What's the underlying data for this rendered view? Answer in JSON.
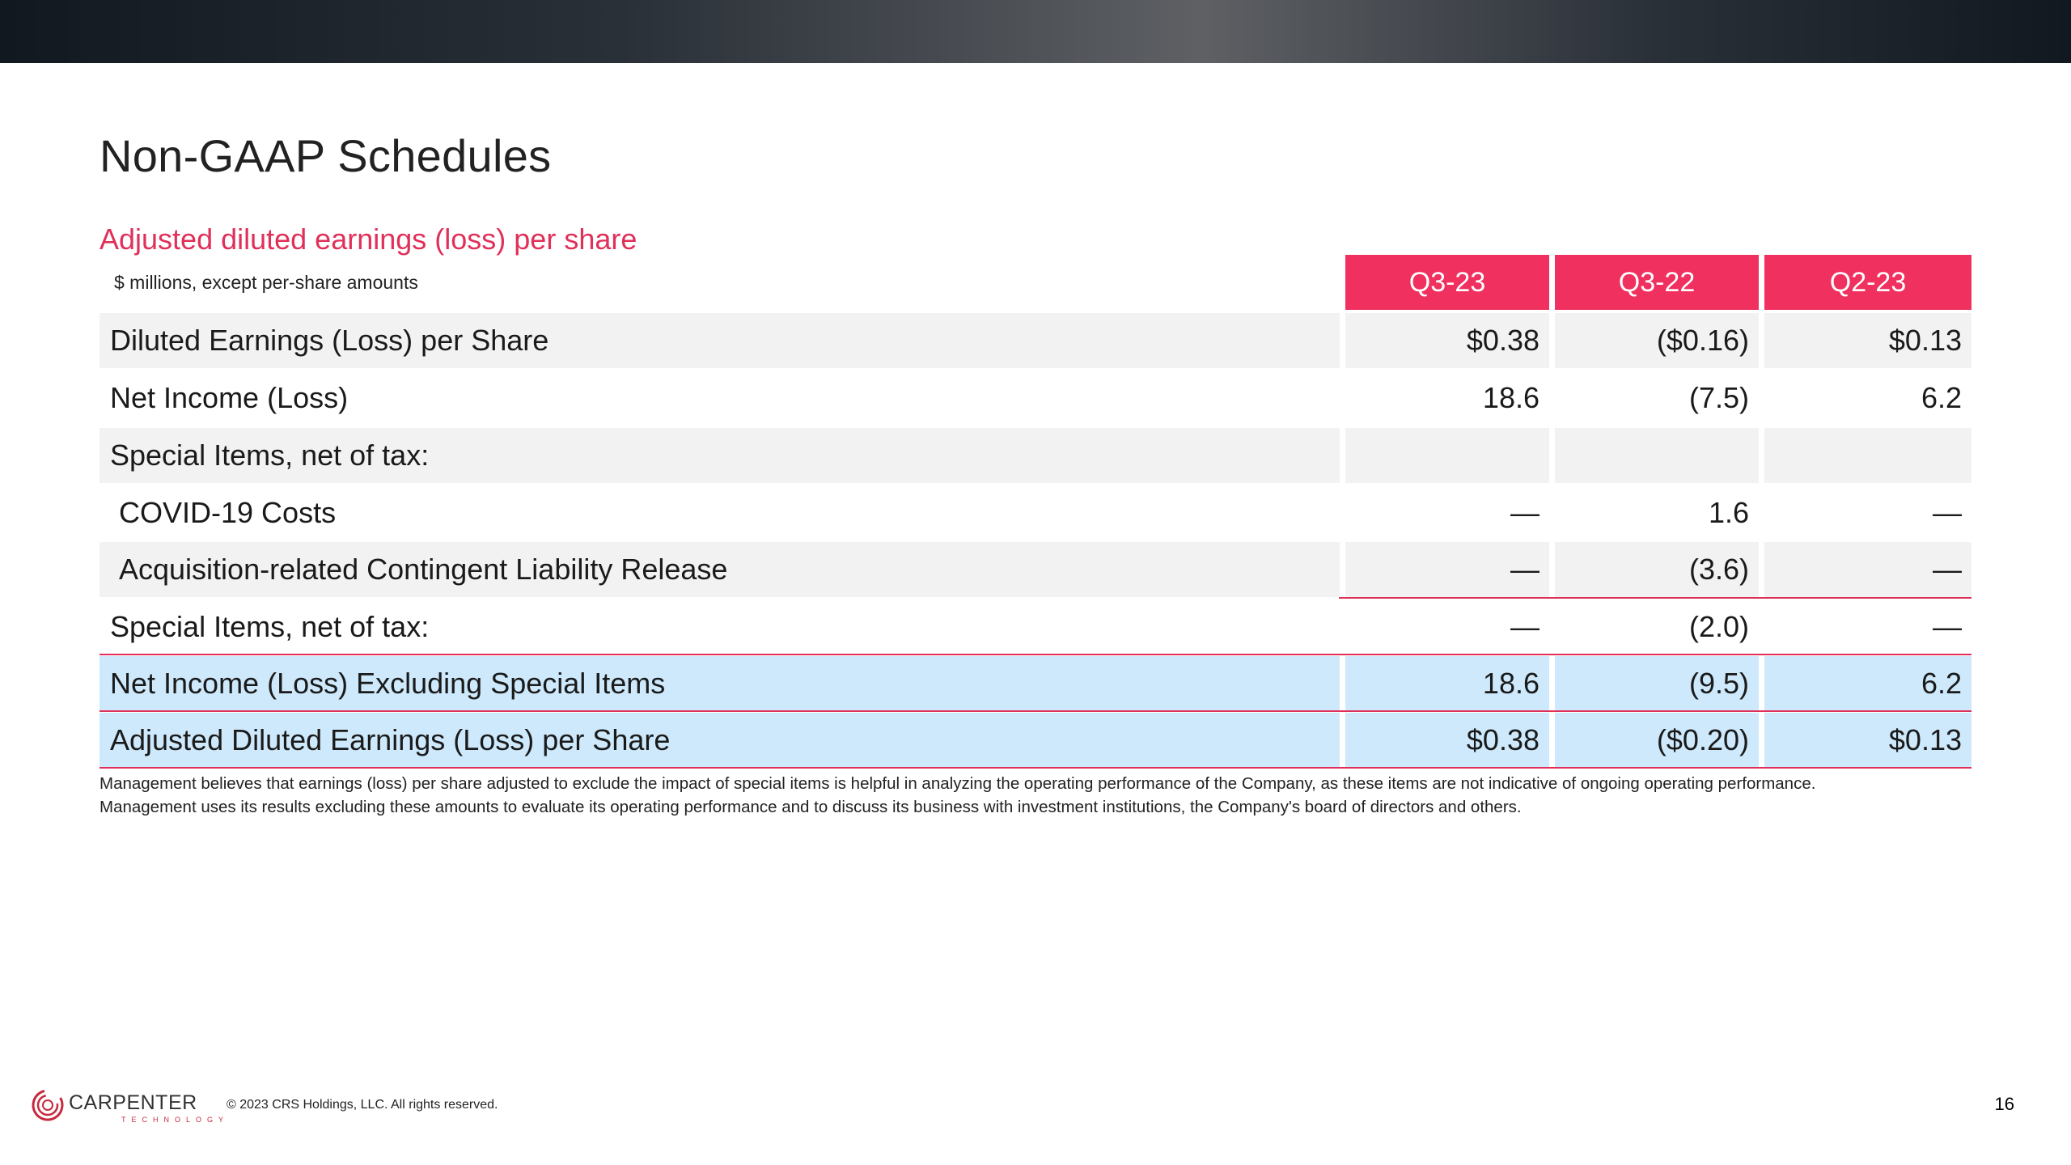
{
  "title": "Non-GAAP Schedules",
  "subtitle": "Adjusted diluted earnings (loss) per share",
  "units_note": "$ millions, except per-share amounts",
  "columns": [
    "Q3-23",
    "Q3-22",
    "Q2-23"
  ],
  "rows": [
    {
      "label": "Diluted Earnings (Loss) per Share",
      "values": [
        "$0.38",
        "($0.16)",
        "$0.13"
      ]
    },
    {
      "label": "Net Income (Loss)",
      "values": [
        "18.6",
        "(7.5)",
        "6.2"
      ]
    },
    {
      "label": "Special Items, net of tax:",
      "values": [
        "",
        "",
        ""
      ]
    },
    {
      "label": "COVID-19 Costs",
      "values": [
        "—",
        "1.6",
        "—"
      ]
    },
    {
      "label": "Acquisition-related Contingent Liability Release",
      "values": [
        "—",
        "(3.6)",
        "—"
      ]
    },
    {
      "label": "Special Items, net of tax:",
      "values": [
        "—",
        "(2.0)",
        "—"
      ]
    },
    {
      "label": "Net Income (Loss) Excluding Special Items",
      "values": [
        "18.6",
        "(9.5)",
        "6.2"
      ]
    },
    {
      "label": "Adjusted Diluted Earnings (Loss) per Share",
      "values": [
        "$0.38",
        "($0.20)",
        "$0.13"
      ]
    }
  ],
  "footnote": {
    "line1": "Management believes that earnings (loss) per share adjusted to exclude the impact of special items is helpful in analyzing the operating performance of the Company, as these items are not indicative of ongoing operating performance.",
    "line2": "Management uses its results excluding these amounts to evaluate its operating performance and to discuss its business with investment institutions, the Company's board of directors and others."
  },
  "footer": {
    "logo_name": "CARPENTER",
    "logo_sub": "TECHNOLOGY",
    "copyright": "© 2023 CRS Holdings, LLC. All rights reserved.",
    "page_number": "16"
  },
  "colors": {
    "accent": "#f0305e",
    "highlight_row": "#cde9fb",
    "shaded_row": "#f2f2f2"
  }
}
